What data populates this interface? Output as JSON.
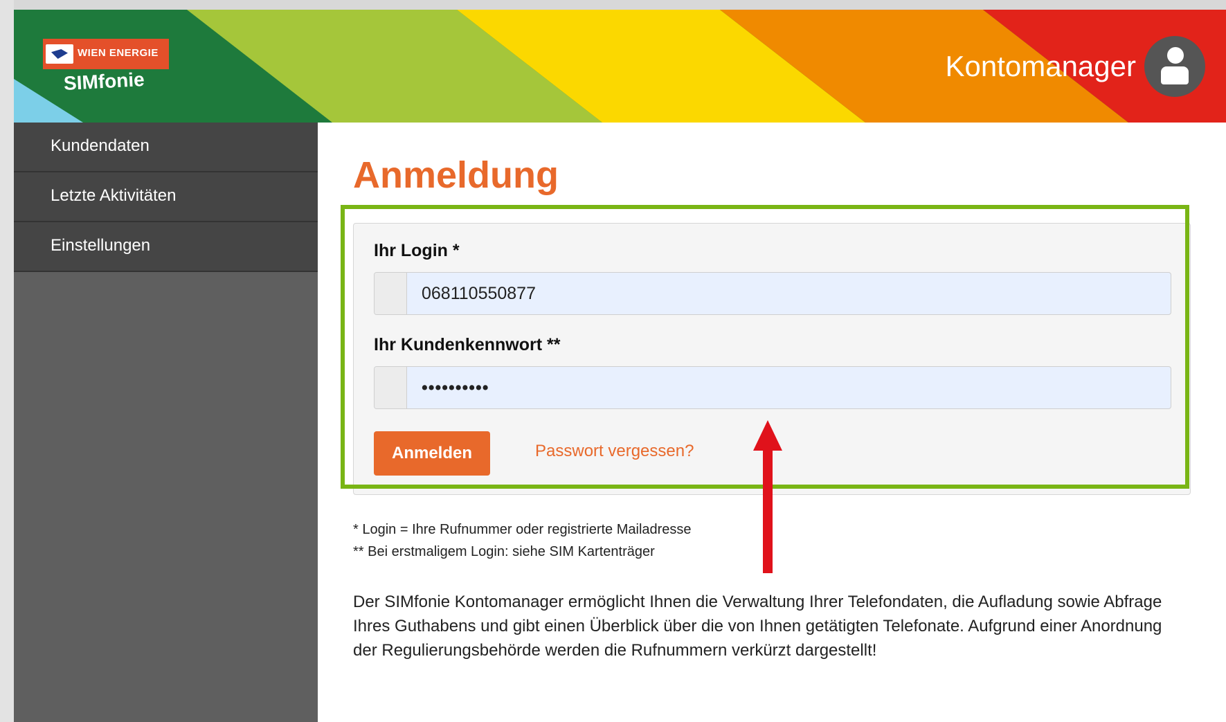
{
  "header": {
    "logo_brand": "WIEN ENERGIE",
    "logo_product": "SIMfonie",
    "title": "Kontomanager",
    "avatar_icon": "user-icon",
    "stripe_colors": [
      "#1e7a3c",
      "#a5c63a",
      "#fbd800",
      "#f08a00",
      "#e2231a",
      "#7ccfe8"
    ]
  },
  "sidebar": {
    "items": [
      {
        "label": "Kundendaten"
      },
      {
        "label": "Letzte Aktivitäten"
      },
      {
        "label": "Einstellungen"
      }
    ]
  },
  "main": {
    "title": "Anmeldung",
    "login_label": "Ihr Login *",
    "login_value": "068110550877",
    "password_label": "Ihr Kundenkennwort **",
    "password_value": "••••••••••",
    "submit_label": "Anmelden",
    "forgot_label": "Passwort vergessen?",
    "footnote_1": "* Login = Ihre Rufnummer oder registrierte Mailadresse",
    "footnote_2": "** Bei erstmaligem Login: siehe SIM Kartenträger",
    "description": "Der SIMfonie Kontomanager ermöglicht Ihnen die Verwaltung Ihrer Telefondaten, die Aufladung sowie Abfrage Ihres Guthabens und gibt einen Überblick über die von Ihnen getätigten Telefonate. Aufgrund einer Anordnung der Regulierungsbehörde werden die Rufnummern verkürzt dargestellt!"
  },
  "annotations": {
    "highlight_color": "#79b515",
    "arrow_color": "#e0121b"
  },
  "colors": {
    "accent": "#e8692b",
    "sidebar_bg": "#5f5f5f",
    "sidebar_item_bg": "#454545"
  }
}
